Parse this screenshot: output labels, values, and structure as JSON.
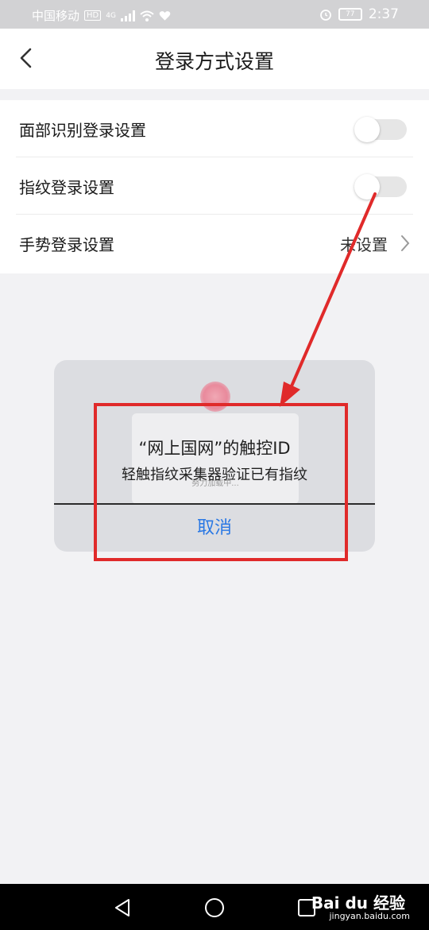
{
  "status_bar": {
    "carrier": "中国移动",
    "network_badge": "HD",
    "network_type": "4G",
    "battery": "77",
    "time": "2:37"
  },
  "nav": {
    "title": "登录方式设置",
    "back_icon": "chevron-left-icon"
  },
  "settings": {
    "rows": [
      {
        "label": "面部识别登录设置",
        "type": "toggle",
        "enabled": false
      },
      {
        "label": "指纹登录设置",
        "type": "toggle",
        "enabled": false
      },
      {
        "label": "手势登录设置",
        "type": "link",
        "value": "未设置"
      }
    ]
  },
  "dialog": {
    "title": "“网上国网”的触控ID",
    "message": "轻触指纹采集器验证已有指纹",
    "loading_text": "努力加载中...",
    "cancel_label": "取消"
  },
  "bottom_nav": {
    "watermark_logo": "Bai du 经验",
    "watermark_url": "jingyan.baidu.com"
  },
  "colors": {
    "accent_blue": "#2a78e4",
    "annotation_red": "#e02a2a",
    "toggle_off": "#e6e6e6"
  }
}
